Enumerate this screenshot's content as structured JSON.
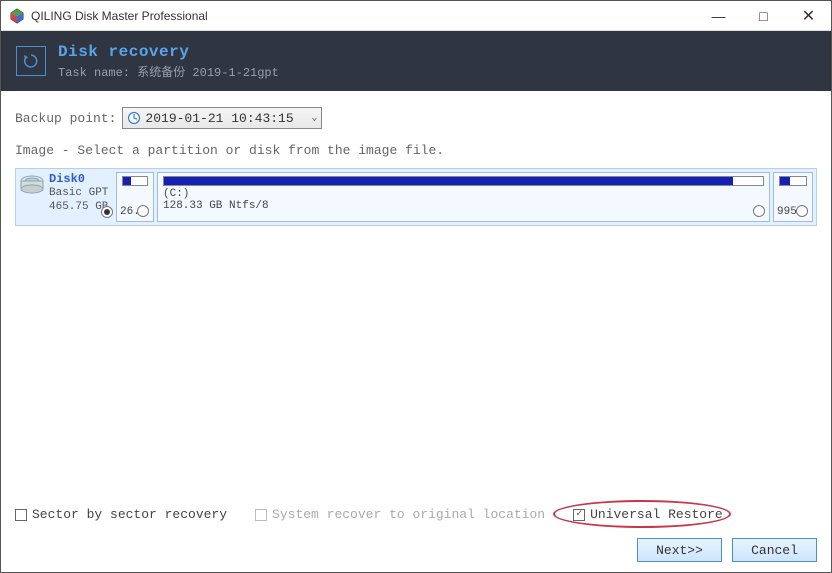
{
  "app": {
    "title": "QILING Disk Master Professional"
  },
  "header": {
    "title": "Disk recovery",
    "task_name_label": "Task name:",
    "task_name_value": "系统备份 2019-1-21gpt"
  },
  "backup_point": {
    "label": "Backup point:",
    "value": "2019-01-21 10:43:15"
  },
  "instruction": "Image - Select a partition or disk from the image file.",
  "disk": {
    "name": "Disk0",
    "type": "Basic GPT",
    "size": "465.75 GB",
    "selected": true
  },
  "partitions": [
    {
      "size_label": "26.",
      "fill_pct": 35,
      "detail": ""
    },
    {
      "size_label": "128.33 GB Ntfs/8",
      "fill_pct": 95,
      "detail": "(C:)"
    },
    {
      "size_label": "995.",
      "fill_pct": 40,
      "detail": ""
    }
  ],
  "checkboxes": {
    "sector": {
      "label": "Sector by sector recovery",
      "checked": false,
      "enabled": true
    },
    "system": {
      "label": "System recover to original location",
      "checked": false,
      "enabled": false
    },
    "universal": {
      "label": "Universal Restore",
      "checked": true,
      "enabled": true
    }
  },
  "buttons": {
    "next": "Next>>",
    "cancel": "Cancel"
  }
}
